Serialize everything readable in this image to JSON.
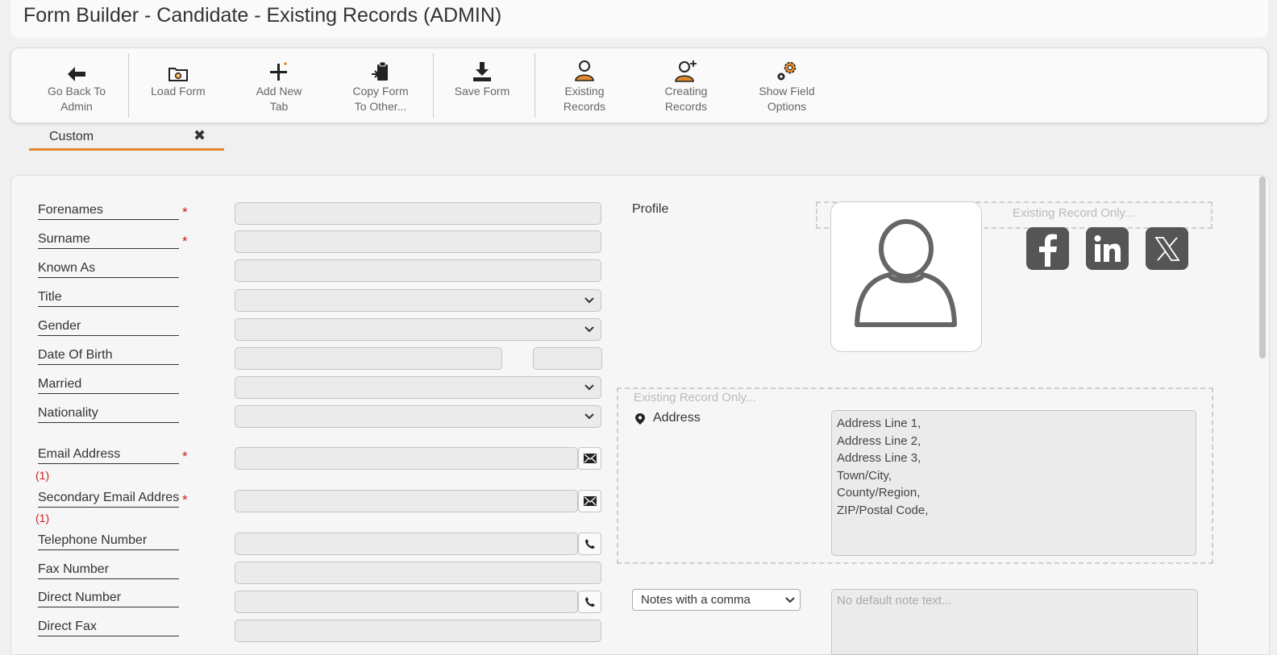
{
  "page": {
    "title": "Form Builder - Candidate - Existing Records (ADMIN)"
  },
  "toolbar": {
    "back_line1": "Go Back To",
    "back_line2": "Admin",
    "load": "Load Form",
    "add_line1": "Add New",
    "add_line2": "Tab",
    "copy_line1": "Copy Form",
    "copy_line2": "To Other...",
    "save": "Save Form",
    "existing_line1": "Existing",
    "existing_line2": "Records",
    "creating_line1": "Creating",
    "creating_line2": "Records",
    "options_line1": "Show Field",
    "options_line2": "Options"
  },
  "tabs": [
    {
      "label": "Custom",
      "close_icon": "x-icon"
    }
  ],
  "fields": {
    "forenames": "Forenames",
    "surname": "Surname",
    "known_as": "Known As",
    "title": "Title",
    "gender": "Gender",
    "dob": "Date Of Birth",
    "married": "Married",
    "nationality": "Nationality",
    "email": "Email Address",
    "secondary_email": "Secondary Email Address",
    "telephone": "Telephone Number",
    "fax": "Fax Number",
    "direct": "Direct Number",
    "direct_fax": "Direct Fax"
  },
  "required_marker": "*",
  "dup_marker": "(1)",
  "profile": {
    "label": "Profile",
    "existing_only": "Existing Record Only...",
    "social_icons": [
      "facebook-icon",
      "linkedin-icon",
      "x-twitter-icon"
    ]
  },
  "address": {
    "existing_only": "Existing Record Only...",
    "label": "Address",
    "text": "Address Line 1,\nAddress Line 2,\nAddress Line 3,\nTown/City,\nCounty/Region,\nZIP/Postal Code,"
  },
  "notes": {
    "select_value": "Notes with a comma",
    "placeholder": "No default note text..."
  },
  "colors": {
    "accent": "#e08a2c",
    "required": "#cc1f1f",
    "social_bg": "#555555"
  }
}
